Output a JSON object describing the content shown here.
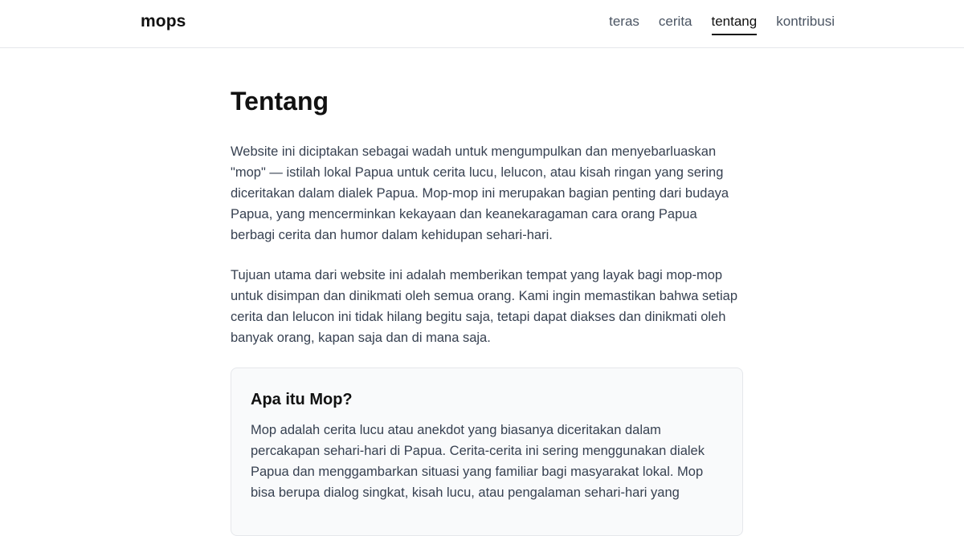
{
  "header": {
    "brand": "mops",
    "nav": [
      {
        "label": "teras",
        "active": false
      },
      {
        "label": "cerita",
        "active": false
      },
      {
        "label": "tentang",
        "active": true
      },
      {
        "label": "kontribusi",
        "active": false
      }
    ]
  },
  "main": {
    "title": "Tentang",
    "paragraphs": [
      "Website ini diciptakan sebagai wadah untuk mengumpulkan dan menyebarluaskan \"mop\" — istilah lokal Papua untuk cerita lucu, lelucon, atau kisah ringan yang sering diceritakan dalam dialek Papua. Mop-mop ini merupakan bagian penting dari budaya Papua, yang mencerminkan kekayaan dan keanekaragaman cara orang Papua berbagi cerita dan humor dalam kehidupan sehari-hari.",
      "Tujuan utama dari website ini adalah memberikan tempat yang layak bagi mop-mop untuk disimpan dan dinikmati oleh semua orang. Kami ingin memastikan bahwa setiap cerita dan lelucon ini tidak hilang begitu saja, tetapi dapat diakses dan dinikmati oleh banyak orang, kapan saja dan di mana saja."
    ],
    "card": {
      "title": "Apa itu Mop?",
      "text": "Mop adalah cerita lucu atau anekdot yang biasanya diceritakan dalam percakapan sehari-hari di Papua. Cerita-cerita ini sering menggunakan dialek Papua dan menggambarkan situasi yang familiar bagi masyarakat lokal. Mop bisa berupa dialog singkat, kisah lucu, atau pengalaman sehari-hari yang"
    }
  }
}
